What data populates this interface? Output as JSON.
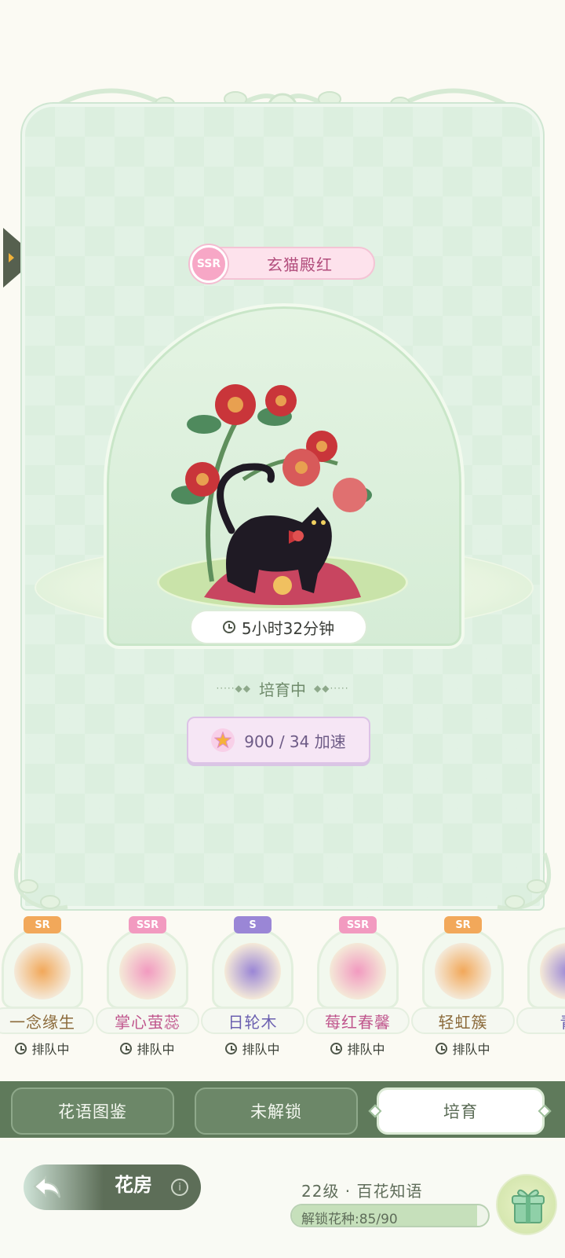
{
  "flower": {
    "rarity": "SSR",
    "name": "玄猫殿红",
    "timer": "5小时32分钟",
    "status": "培育中",
    "speedup_label": "900 / 34 加速"
  },
  "queue": [
    {
      "rarity": "SR",
      "rarity_color": "#f2a85a",
      "name": "一念缘生",
      "name_color": "#8b6a3a",
      "status": "排队中"
    },
    {
      "rarity": "SSR",
      "rarity_color": "#f29ac0",
      "name": "掌心萤蕊",
      "name_color": "#c0568d",
      "status": "排队中"
    },
    {
      "rarity": "S",
      "rarity_color": "#9a86d6",
      "name": "日轮木",
      "name_color": "#6b60b0",
      "status": "排队中"
    },
    {
      "rarity": "SSR",
      "rarity_color": "#f29ac0",
      "name": "莓红春馨",
      "name_color": "#c0568d",
      "status": "排队中"
    },
    {
      "rarity": "SR",
      "rarity_color": "#f2a85a",
      "name": "轻虹簇",
      "name_color": "#8b6a3a",
      "status": "排队中"
    },
    {
      "rarity": "",
      "rarity_color": "#9a86d6",
      "name": "青",
      "name_color": "#6b60b0",
      "status": ""
    }
  ],
  "tabs": {
    "catalog": "花语图鉴",
    "locked": "未解锁",
    "cultivate": "培育"
  },
  "footer": {
    "home_label": "花房",
    "info_glyph": "i",
    "level_text": "22级 · 百花知语",
    "unlock_text": "解锁花种:85/90",
    "unlock_fraction": 0.944
  },
  "icons": {
    "back": "back-arrow-icon",
    "clock": "clock-icon",
    "star": "star-icon",
    "gift": "gift-icon"
  }
}
